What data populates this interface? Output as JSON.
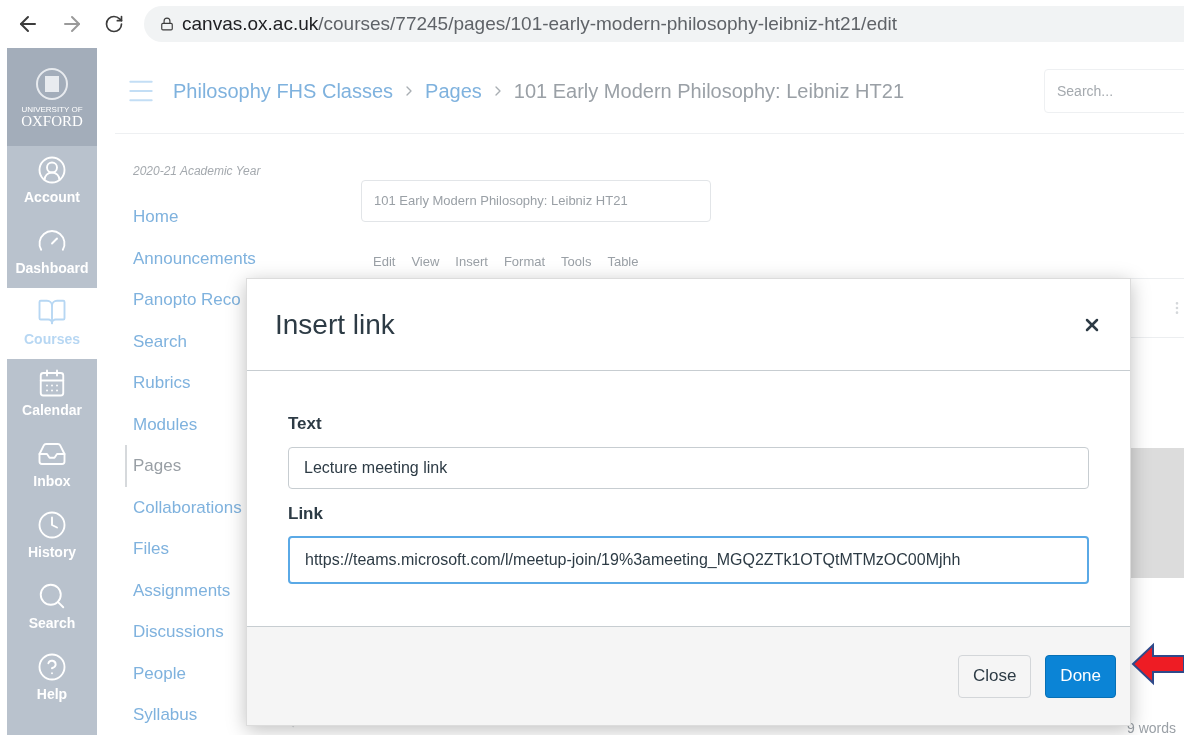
{
  "browser": {
    "url_host": "canvas.ox.ac.uk",
    "url_path": "/courses/77245/pages/101-early-modern-philosophy-leibniz-ht21/edit"
  },
  "global_nav": {
    "logo": {
      "top": "UNIVERSITY OF",
      "bottom": "OXFORD"
    },
    "items": [
      {
        "label": "Account",
        "selected": false
      },
      {
        "label": "Dashboard",
        "selected": false
      },
      {
        "label": "Courses",
        "selected": true
      },
      {
        "label": "Calendar",
        "selected": false
      },
      {
        "label": "Inbox",
        "selected": false
      },
      {
        "label": "History",
        "selected": false
      },
      {
        "label": "Search",
        "selected": false
      },
      {
        "label": "Help",
        "selected": false
      }
    ]
  },
  "breadcrumb": [
    {
      "label": "Philosophy FHS Classes",
      "kind": "link"
    },
    {
      "label": "Pages",
      "kind": "link"
    },
    {
      "label": "101 Early Modern Philosophy: Leibniz HT21",
      "kind": "current"
    }
  ],
  "header_search": {
    "placeholder": "Search..."
  },
  "course_nav": {
    "term": "2020-21 Academic Year",
    "items": [
      {
        "label": "Home",
        "selected": false
      },
      {
        "label": "Announcements",
        "selected": false
      },
      {
        "label": "Panopto Reco",
        "selected": false
      },
      {
        "label": "Search",
        "selected": false
      },
      {
        "label": "Rubrics",
        "selected": false
      },
      {
        "label": "Modules",
        "selected": false
      },
      {
        "label": "Pages",
        "selected": true
      },
      {
        "label": "Collaborations",
        "selected": false
      },
      {
        "label": "Files",
        "selected": false
      },
      {
        "label": "Assignments",
        "selected": false
      },
      {
        "label": "Discussions",
        "selected": false
      },
      {
        "label": "People",
        "selected": false
      },
      {
        "label": "Syllabus",
        "selected": false
      }
    ]
  },
  "editor": {
    "title_value": "101 Early Modern Philosophy: Leibniz HT21",
    "menu": [
      "Edit",
      "View",
      "Insert",
      "Format",
      "Tools",
      "Table"
    ],
    "word_count": "9 words"
  },
  "dialog": {
    "title": "Insert link",
    "fields": [
      {
        "label": "Text",
        "value": "Lecture meeting link",
        "focused": false
      },
      {
        "label": "Link",
        "value": "https://teams.microsoft.com/l/meetup-join/19%3ameeting_MGQ2ZTk1OTQtMTMzOC00Mjhh",
        "focused": true
      }
    ],
    "buttons": [
      {
        "label": "Close",
        "kind": "secondary"
      },
      {
        "label": "Done",
        "kind": "primary"
      }
    ]
  }
}
